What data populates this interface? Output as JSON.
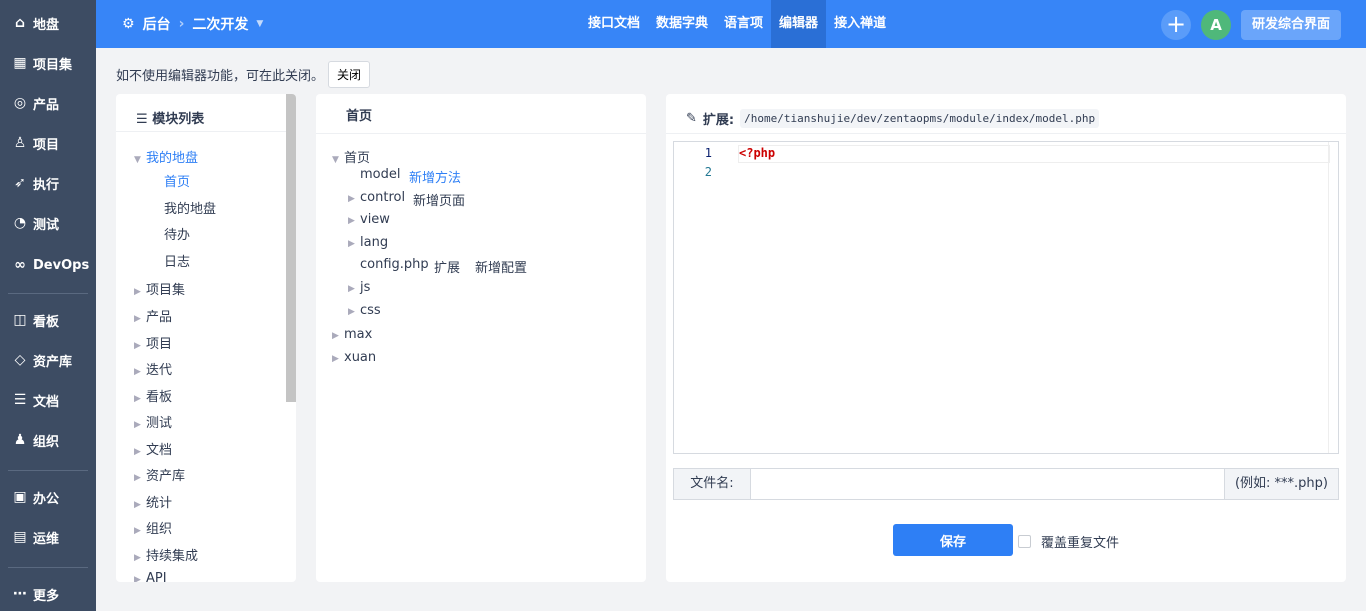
{
  "sidebar": {
    "items": [
      {
        "label": "地盘",
        "icon": "home-icon",
        "glyph": "⌂"
      },
      {
        "label": "项目集",
        "icon": "grid-icon",
        "glyph": "▦"
      },
      {
        "label": "产品",
        "icon": "lightbulb-icon",
        "glyph": "◎"
      },
      {
        "label": "项目",
        "icon": "project-icon",
        "glyph": "♙"
      },
      {
        "label": "执行",
        "icon": "run-icon",
        "glyph": "➶"
      },
      {
        "label": "测试",
        "icon": "test-icon",
        "glyph": "◔"
      },
      {
        "label": "DevOps",
        "icon": "infinity-icon",
        "glyph": "∞"
      },
      {
        "label": "看板",
        "icon": "kanban-icon",
        "glyph": "◫"
      },
      {
        "label": "资产库",
        "icon": "diamond-icon",
        "glyph": "◇"
      },
      {
        "label": "文档",
        "icon": "doc-icon",
        "glyph": "☰"
      },
      {
        "label": "组织",
        "icon": "user-icon",
        "glyph": "♟"
      },
      {
        "label": "办公",
        "icon": "oa-icon",
        "glyph": "▣"
      },
      {
        "label": "运维",
        "icon": "ops-icon",
        "glyph": "▤"
      },
      {
        "label": "更多",
        "icon": "more-icon",
        "glyph": "⋯"
      }
    ]
  },
  "topbar": {
    "home": "后台",
    "section": "二次开发",
    "nav": [
      "接口文档",
      "数据字典",
      "语言项",
      "编辑器",
      "接入禅道"
    ],
    "active": "编辑器",
    "avatar": "A",
    "switch": "研发综合界面"
  },
  "notice": {
    "text": "如不使用编辑器功能，可在此关闭。",
    "close": "关闭"
  },
  "modules": {
    "title": "模块列表",
    "items": [
      "我的地盘",
      "首页",
      "我的地盘",
      "待办",
      "日志",
      "项目集",
      "产品",
      "项目",
      "迭代",
      "看板",
      "测试",
      "文档",
      "资产库",
      "统计",
      "组织",
      "持续集成",
      "API"
    ]
  },
  "files": {
    "title": "首页",
    "items": [
      "首页",
      "model",
      "新增方法",
      "control",
      "新增页面",
      "view",
      "lang",
      "config.php",
      "扩展",
      "新增配置",
      "js",
      "css",
      "max",
      "xuan"
    ]
  },
  "editor": {
    "label": "扩展:",
    "path": "/home/tianshujie/dev/zentaopms/module/index/model.php",
    "lines": [
      "1",
      "2"
    ],
    "code": "<?php",
    "filename_label": "文件名:",
    "filename_value": "",
    "suffix_hint": "(例如: ***.php)",
    "save": "保存",
    "overwrite": "覆盖重复文件"
  }
}
